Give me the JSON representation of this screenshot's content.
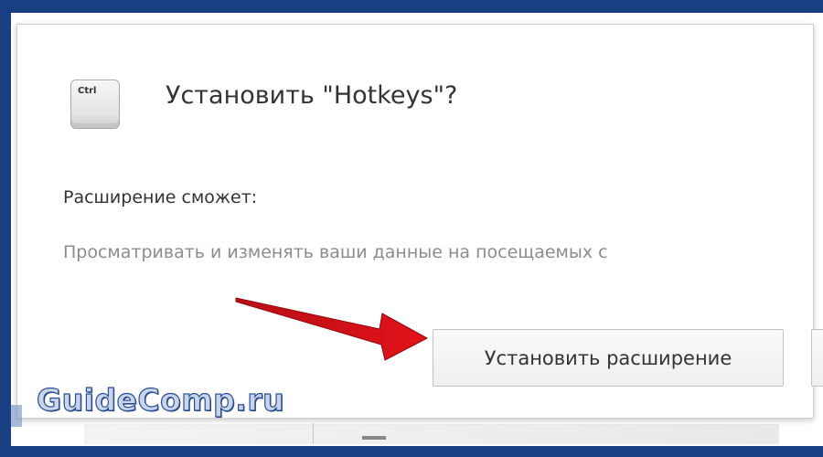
{
  "dialog": {
    "icon_label": "Ctrl",
    "title": "Установить \"Hotkeys\"?",
    "can_label": "Расширение сможет:",
    "permission": "Просматривать и изменять ваши данные на посещаемых с",
    "install_button": "Установить расширение",
    "cancel_button": ""
  },
  "watermark": {
    "text": "GuideComp.ru"
  },
  "colors": {
    "frame": "#1a3e82",
    "arrow": "#e3121a",
    "title_text": "#333333",
    "permission_text": "#8c8c8c"
  },
  "icons": [
    "ctrl-key-icon",
    "red-arrow-icon"
  ]
}
